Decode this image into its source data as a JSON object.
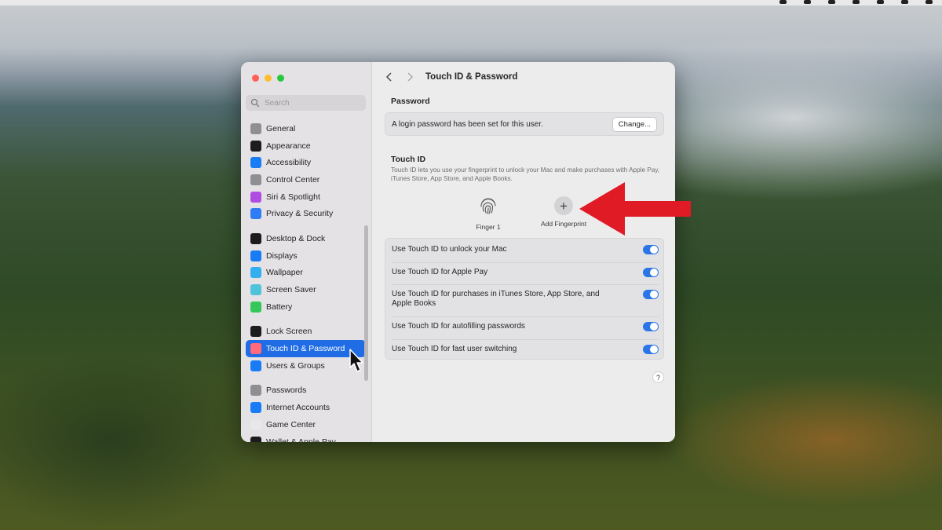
{
  "colors": {
    "accent": "#1f6ce5",
    "toggle_on": "#2a76e8",
    "arrow": "#e01b26"
  },
  "sidebar": {
    "search_placeholder": "Search",
    "items": [
      {
        "label": "General",
        "icon": "gear-icon",
        "color": "#8e8e93"
      },
      {
        "label": "Appearance",
        "icon": "appearance-icon",
        "color": "#1c1c1e"
      },
      {
        "label": "Accessibility",
        "icon": "accessibility-icon",
        "color": "#1a7cf5"
      },
      {
        "label": "Control Center",
        "icon": "control-center-icon",
        "color": "#8e8e93"
      },
      {
        "label": "Siri & Spotlight",
        "icon": "siri-icon",
        "color": "#b04de0"
      },
      {
        "label": "Privacy & Security",
        "icon": "hand-icon",
        "color": "#2f7cf5"
      },
      {
        "label": "Desktop & Dock",
        "icon": "dock-icon",
        "color": "#1c1c1e"
      },
      {
        "label": "Displays",
        "icon": "display-icon",
        "color": "#1a7cf5"
      },
      {
        "label": "Wallpaper",
        "icon": "wallpaper-icon",
        "color": "#35aef0"
      },
      {
        "label": "Screen Saver",
        "icon": "screen-saver-icon",
        "color": "#4fc3d9"
      },
      {
        "label": "Battery",
        "icon": "battery-icon",
        "color": "#34c759"
      },
      {
        "label": "Lock Screen",
        "icon": "lock-icon",
        "color": "#1c1c1e"
      },
      {
        "label": "Touch ID & Password",
        "icon": "fingerprint-icon",
        "color": "#ff6b7a"
      },
      {
        "label": "Users & Groups",
        "icon": "users-icon",
        "color": "#1a7cf5"
      },
      {
        "label": "Passwords",
        "icon": "key-icon",
        "color": "#8e8e93"
      },
      {
        "label": "Internet Accounts",
        "icon": "at-icon",
        "color": "#1a7cf5"
      },
      {
        "label": "Game Center",
        "icon": "game-center-icon",
        "color": "#e8e8e8"
      },
      {
        "label": "Wallet & Apple Pay",
        "icon": "wallet-icon",
        "color": "#1c1c1e"
      }
    ]
  },
  "main": {
    "title": "Touch ID & Password",
    "password": {
      "heading": "Password",
      "status": "A login password has been set for this user.",
      "change_button": "Change..."
    },
    "touch_id": {
      "heading": "Touch ID",
      "description": "Touch ID lets you use your fingerprint to unlock your Mac and make purchases with Apple Pay, iTunes Store, App Store, and Apple Books.",
      "finger_label": "Finger 1",
      "add_label": "Add Fingerprint",
      "add_symbol": "+"
    },
    "options": [
      {
        "label": "Use Touch ID to unlock your Mac",
        "on": true
      },
      {
        "label": "Use Touch ID for Apple Pay",
        "on": true
      },
      {
        "label": "Use Touch ID for purchases in iTunes Store, App Store, and Apple Books",
        "on": true
      },
      {
        "label": "Use Touch ID for autofilling passwords",
        "on": true
      },
      {
        "label": "Use Touch ID for fast user switching",
        "on": true
      }
    ],
    "help": "?"
  }
}
